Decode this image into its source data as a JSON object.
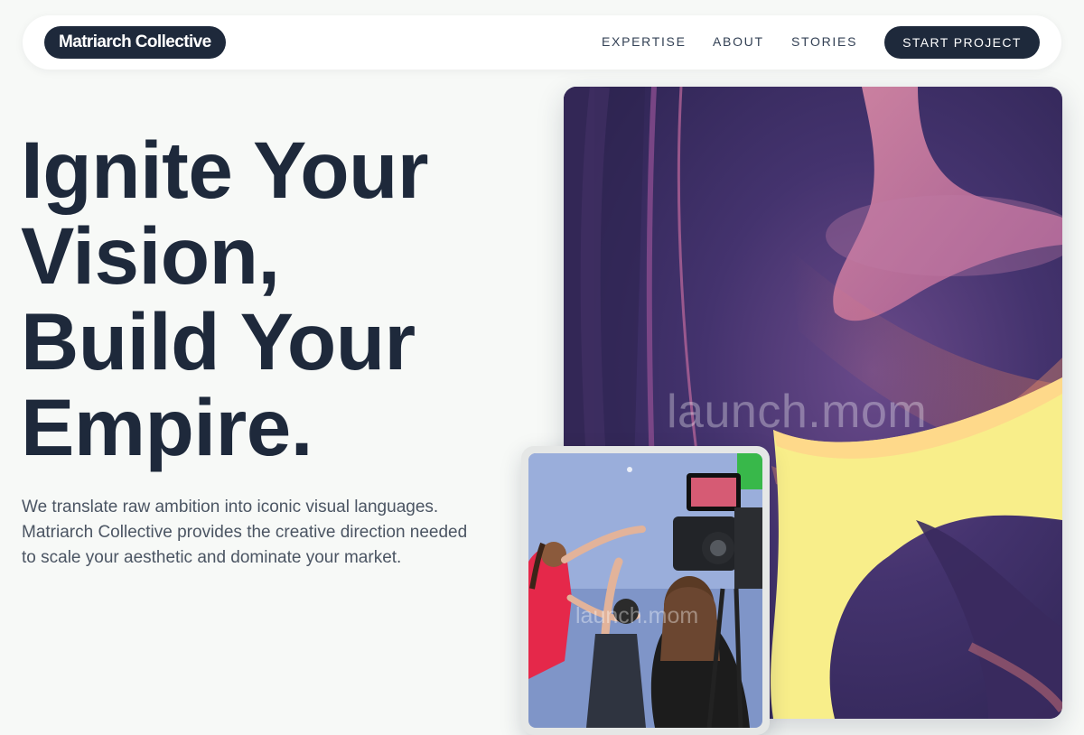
{
  "header": {
    "brand": "Matriarch Collective",
    "nav": [
      "EXPERTISE",
      "ABOUT",
      "STORIES"
    ],
    "cta": "START PROJECT"
  },
  "hero": {
    "headline_lines": [
      "Ignite Your",
      "Vision,",
      "Build Your",
      "Empire."
    ],
    "subtext": "We translate raw ambition into iconic visual languages. Matriarch Collective provides the creative direction needed to scale your aesthetic and dominate your market."
  },
  "media": {
    "main_image_watermark": "launch.mom",
    "secondary_image_watermark": "launch.mom"
  },
  "colors": {
    "ink": "#1e293b",
    "background": "#f7f9f7",
    "body_text": "#4b5563",
    "accent_yellow": "#f8ee8a",
    "accent_purple": "#3b2d66"
  }
}
